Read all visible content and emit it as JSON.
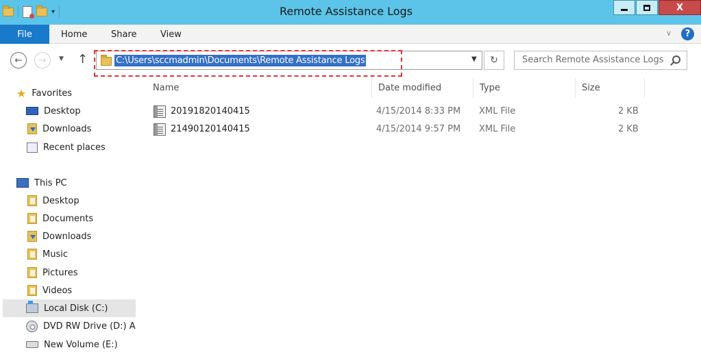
{
  "window": {
    "title": "Remote Assistance Logs"
  },
  "ribbon": {
    "tabs": [
      "File",
      "Home",
      "Share",
      "View"
    ]
  },
  "address": {
    "path": "C:\\Users\\sccmadmin\\Documents\\Remote Assistance Logs"
  },
  "search": {
    "placeholder": "Search Remote Assistance Logs"
  },
  "nav_pane": {
    "favorites": {
      "label": "Favorites",
      "items": [
        "Desktop",
        "Downloads",
        "Recent places"
      ]
    },
    "this_pc": {
      "label": "This PC",
      "items": [
        "Desktop",
        "Documents",
        "Downloads",
        "Music",
        "Pictures",
        "Videos",
        "Local Disk (C:)",
        "DVD RW Drive (D:) A",
        "New Volume (E:)"
      ]
    },
    "selected": "Local Disk (C:)"
  },
  "file_list": {
    "columns": [
      "Name",
      "Date modified",
      "Type",
      "Size"
    ],
    "rows": [
      {
        "name": "20191820140415",
        "date": "4/15/2014 8:33 PM",
        "type": "XML File",
        "size": "2 KB"
      },
      {
        "name": "21490120140415",
        "date": "4/15/2014 9:57 PM",
        "type": "XML File",
        "size": "2 KB"
      }
    ]
  },
  "colors": {
    "titlebar": "#5cc4e8",
    "file_tab": "#1979ca",
    "address_selection": "#3470c8",
    "annotation": "#e23333",
    "close_button": "#c74b4b"
  },
  "icons": [
    "folder-icon",
    "properties-icon",
    "back-icon",
    "forward-icon",
    "up-icon",
    "refresh-icon",
    "search-icon",
    "help-icon",
    "xml-file-icon"
  ]
}
